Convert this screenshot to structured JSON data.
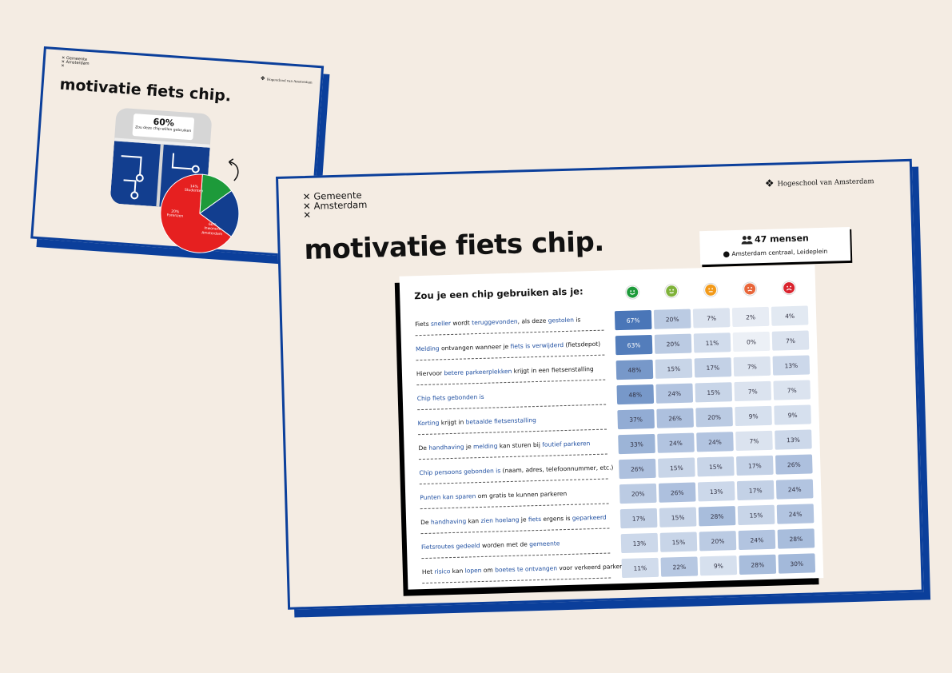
{
  "colors": {
    "background": "#f4ece3",
    "brand_blue": "#0b3f9b",
    "highlight_text": "#1f4fa1",
    "pie_red": "#e62020",
    "pie_blue": "#123e8f",
    "pie_green": "#1d9a3a"
  },
  "back_slide": {
    "logo_line1": "Gemeente",
    "logo_line2": "Amsterdam",
    "hva_label": "Hogeschool van Amsterdam",
    "title": "motivatie fiets chip.",
    "stat_value": "60%",
    "stat_caption": "Zou deze chip willen gebruiken",
    "pie": [
      {
        "label_line1": "14%",
        "label_line2": "Studenten",
        "value": 14,
        "color": "#1d9a3a"
      },
      {
        "label_line1": "20%",
        "label_line2": "Forenzen",
        "value": 20,
        "color": "#123e8f"
      },
      {
        "label_line1": "66%",
        "label_line2": "Inwoners Amsterdam",
        "value": 66,
        "color": "#e62020"
      }
    ]
  },
  "front_slide": {
    "logo_line1": "Gemeente",
    "logo_line2": "Amsterdam",
    "hva_label": "Hogeschool van Amsterdam",
    "title": "motivatie fiets chip.",
    "people_count": "47 mensen",
    "location": "Amsterdam centraal, Leideplein",
    "table_heading": "Zou je een chip gebruiken als je:",
    "faces": [
      {
        "name": "very-happy-face-icon",
        "color": "#1d9a3a"
      },
      {
        "name": "happy-face-icon",
        "color": "#7fb23a"
      },
      {
        "name": "neutral-face-icon",
        "color": "#f29a1a"
      },
      {
        "name": "unhappy-face-icon",
        "color": "#e8663a"
      },
      {
        "name": "very-unhappy-face-icon",
        "color": "#d9232d"
      }
    ],
    "rows": [
      {
        "parts": [
          [
            "Fiets ",
            0
          ],
          [
            "sneller",
            1
          ],
          [
            " wordt ",
            0
          ],
          [
            "teruggevonden",
            1
          ],
          [
            ", als deze ",
            0
          ],
          [
            "gestolen",
            1
          ],
          [
            " is",
            0
          ]
        ],
        "values": [
          "67%",
          "20%",
          "7%",
          "2%",
          "4%"
        ],
        "levels": [
          67,
          20,
          7,
          2,
          4
        ]
      },
      {
        "parts": [
          [
            "Melding",
            1
          ],
          [
            " ontvangen wanneer je ",
            0
          ],
          [
            "fiets is verwijderd",
            1
          ],
          [
            " (fietsdepot)",
            0
          ]
        ],
        "values": [
          "63%",
          "20%",
          "11%",
          "0%",
          "7%"
        ],
        "levels": [
          63,
          20,
          11,
          0,
          7
        ]
      },
      {
        "parts": [
          [
            "Hiervoor ",
            0
          ],
          [
            "betere parkeerplekken",
            1
          ],
          [
            " krijgt in een fietsenstalling",
            0
          ]
        ],
        "values": [
          "48%",
          "15%",
          "17%",
          "7%",
          "13%"
        ],
        "levels": [
          48,
          15,
          17,
          7,
          13
        ]
      },
      {
        "parts": [
          [
            "Chip fiets gebonden is",
            1
          ]
        ],
        "values": [
          "48%",
          "24%",
          "15%",
          "7%",
          "7%"
        ],
        "levels": [
          48,
          24,
          15,
          7,
          7
        ]
      },
      {
        "parts": [
          [
            "Korting",
            1
          ],
          [
            " krijgt in ",
            0
          ],
          [
            "betaalde fietsenstalling",
            1
          ]
        ],
        "values": [
          "37%",
          "26%",
          "20%",
          "9%",
          "9%"
        ],
        "levels": [
          37,
          26,
          20,
          9,
          9
        ]
      },
      {
        "parts": [
          [
            "De ",
            0
          ],
          [
            "handhaving",
            1
          ],
          [
            " je ",
            0
          ],
          [
            "melding",
            1
          ],
          [
            " kan sturen bij ",
            0
          ],
          [
            "foutief parkeren",
            1
          ]
        ],
        "values": [
          "33%",
          "24%",
          "24%",
          "7%",
          "13%"
        ],
        "levels": [
          33,
          24,
          24,
          7,
          13
        ]
      },
      {
        "parts": [
          [
            "Chip persoons gebonden is",
            1
          ],
          [
            " (naam, adres, telefoonnummer, etc.)",
            0
          ]
        ],
        "values": [
          "26%",
          "15%",
          "15%",
          "17%",
          "26%"
        ],
        "levels": [
          26,
          15,
          15,
          17,
          26
        ]
      },
      {
        "parts": [
          [
            "Punten kan sparen",
            1
          ],
          [
            " om gratis te kunnen parkeren",
            0
          ]
        ],
        "values": [
          "20%",
          "26%",
          "13%",
          "17%",
          "24%"
        ],
        "levels": [
          20,
          26,
          13,
          17,
          24
        ]
      },
      {
        "parts": [
          [
            "De ",
            0
          ],
          [
            "handhaving",
            1
          ],
          [
            " kan ",
            0
          ],
          [
            "zien hoelang",
            1
          ],
          [
            " je ",
            0
          ],
          [
            "fiets",
            1
          ],
          [
            " ergens is ",
            0
          ],
          [
            "geparkeerd",
            1
          ]
        ],
        "values": [
          "17%",
          "15%",
          "28%",
          "15%",
          "24%"
        ],
        "levels": [
          17,
          15,
          28,
          15,
          24
        ]
      },
      {
        "parts": [
          [
            "Fietsroutes gedeeld",
            1
          ],
          [
            " worden met de ",
            0
          ],
          [
            "gemeente",
            1
          ]
        ],
        "values": [
          "13%",
          "15%",
          "20%",
          "24%",
          "28%"
        ],
        "levels": [
          13,
          15,
          20,
          24,
          28
        ]
      },
      {
        "parts": [
          [
            "Het ",
            0
          ],
          [
            "risico",
            1
          ],
          [
            " kan ",
            0
          ],
          [
            "lopen",
            1
          ],
          [
            " om ",
            0
          ],
          [
            "boetes te ontvangen",
            1
          ],
          [
            " voor verkeerd parkeren",
            0
          ]
        ],
        "values": [
          "11%",
          "22%",
          "9%",
          "28%",
          "30%"
        ],
        "levels": [
          11,
          22,
          9,
          28,
          30
        ]
      }
    ]
  }
}
